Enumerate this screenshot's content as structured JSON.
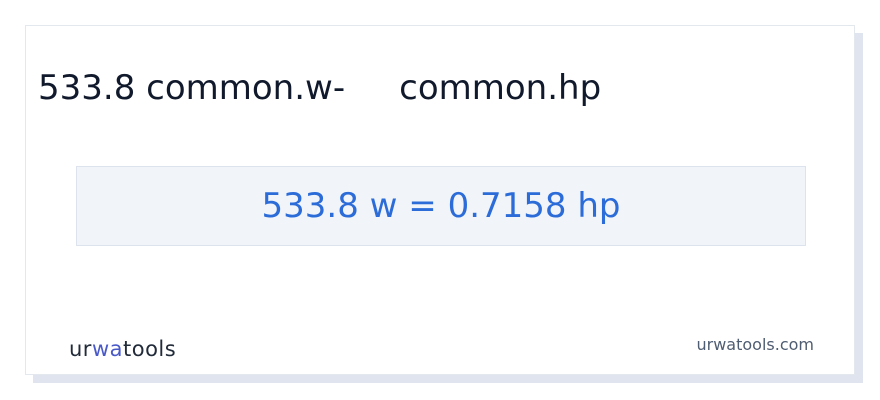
{
  "header": {
    "from_text": "533.8 common.w-",
    "to_text": "common.hp"
  },
  "result": {
    "text": "533.8 w = 0.7158 hp"
  },
  "footer": {
    "logo_part1": "ur",
    "logo_part2": "wa",
    "logo_part3": "tools",
    "site": "urwatools.com"
  },
  "colors": {
    "result_text": "#2b6cd9",
    "result_background": "#f1f4f8",
    "logo_accent": "#4a59c8"
  }
}
